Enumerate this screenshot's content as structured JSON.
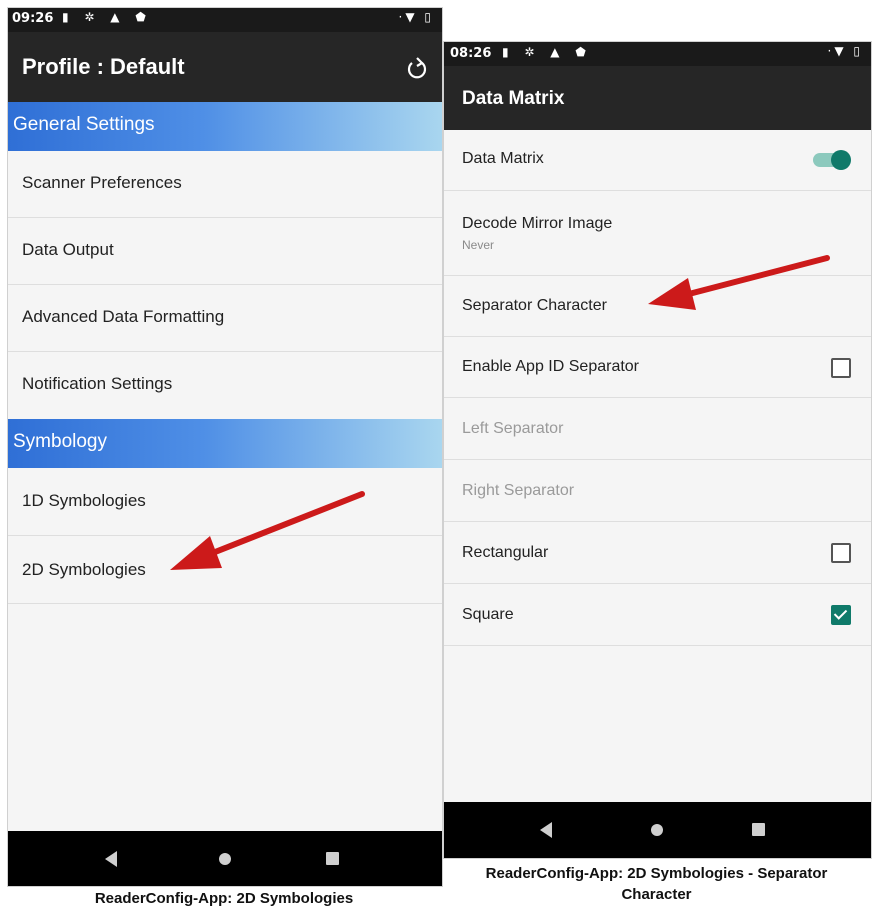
{
  "left_screen": {
    "status": {
      "time": "09:26"
    },
    "title": "Profile : Default",
    "sections": [
      {
        "header": "General Settings",
        "items": [
          "Scanner Preferences",
          "Data Output",
          "Advanced Data Formatting",
          "Notification Settings"
        ]
      },
      {
        "header": "Symbology",
        "items": [
          "1D Symbologies",
          "2D Symbologies"
        ]
      }
    ],
    "caption": "ReaderConfig-App: 2D Symbologies"
  },
  "right_screen": {
    "status": {
      "time": "08:26"
    },
    "title": "Data Matrix",
    "rows": [
      {
        "label": "Data Matrix",
        "control": "toggle",
        "state": "on"
      },
      {
        "label": "Decode Mirror Image",
        "summary": "Never"
      },
      {
        "label": "Separator Character"
      },
      {
        "label": "Enable App ID Separator",
        "control": "checkbox",
        "state": "unchecked"
      },
      {
        "label": "Left Separator",
        "state": "disabled"
      },
      {
        "label": "Right Separator",
        "state": "disabled"
      },
      {
        "label": "Rectangular",
        "control": "checkbox",
        "state": "unchecked"
      },
      {
        "label": "Square",
        "control": "checkbox",
        "state": "checked"
      }
    ],
    "caption_line1": "ReaderConfig-App: 2D Symbologies - Separator",
    "caption_line2": "Character"
  },
  "colors": {
    "accent": "#0f7a6a",
    "section_start": "#2f6fd6",
    "section_end": "#a9d6ef",
    "arrow": "#d11a1a"
  }
}
